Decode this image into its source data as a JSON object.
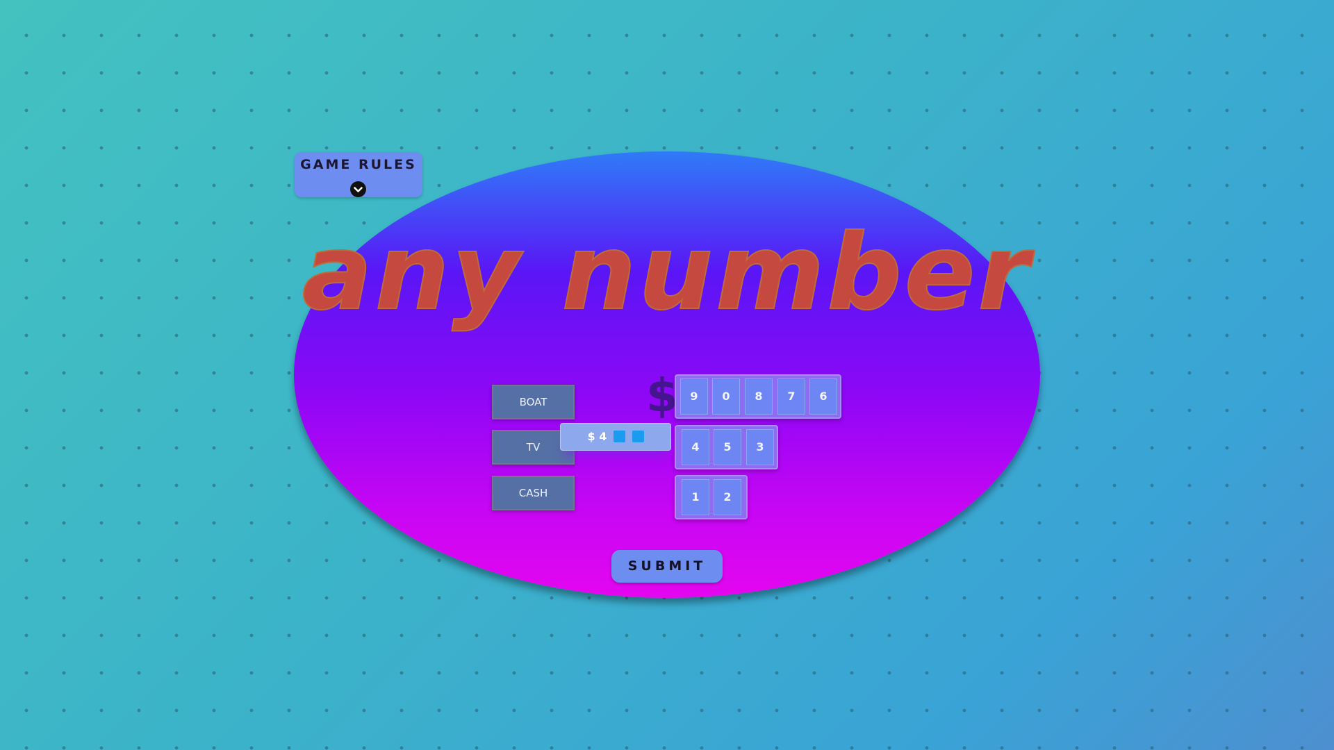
{
  "rules": {
    "title": "GAME RULES",
    "toggle_icon": "chevron-down-icon"
  },
  "game": {
    "title": "any number"
  },
  "prizes": {
    "boat": "BOAT",
    "tv": "TV",
    "cash": "CASH"
  },
  "guess": {
    "prefix": "$",
    "filled_digit": "4",
    "empty_slots": 2
  },
  "currency_symbol": "$",
  "digit_rows": {
    "row1": [
      "9",
      "0",
      "8",
      "7",
      "6"
    ],
    "row2": [
      "4",
      "5",
      "3"
    ],
    "row3": [
      "1",
      "2"
    ]
  },
  "submit": {
    "label": "SUBMIT"
  },
  "colors": {
    "background": "#3fb6c4",
    "board_top": "#2f7bf8",
    "board_bottom": "#e506ef",
    "title": "#c5493f",
    "prize_button": "#5470a5",
    "digit_tile": "#6e86f3",
    "empty_slot": "#1a9bf0"
  }
}
